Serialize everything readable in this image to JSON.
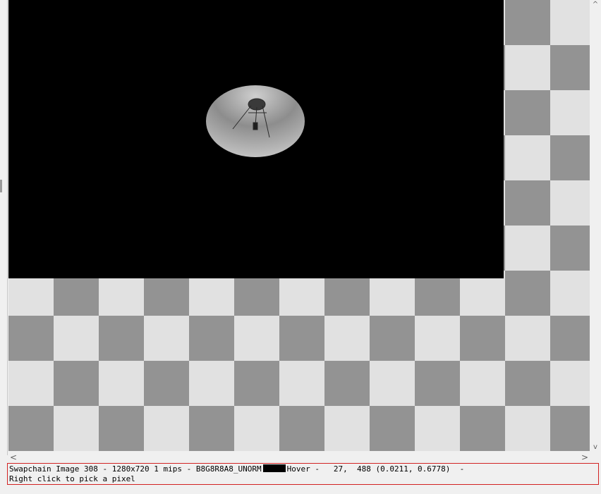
{
  "status": {
    "texture_info": "Swapchain Image 308 - 1280x720 1 mips - B8G8R8A8_UNORM",
    "hover_label": "Hover -",
    "hover_coords": "   27,  488 (0.0211, 0.6778)  -",
    "hint": "Right click to pick a pixel",
    "swatch_color": "#000000"
  },
  "scrollbars": {
    "up_arrow": "^",
    "down_arrow": "v",
    "left_arrow": "<",
    "right_arrow": ">"
  },
  "colors": {
    "checker_light": "#e1e1e1",
    "checker_dark": "#939393",
    "status_border": "#d22222"
  }
}
